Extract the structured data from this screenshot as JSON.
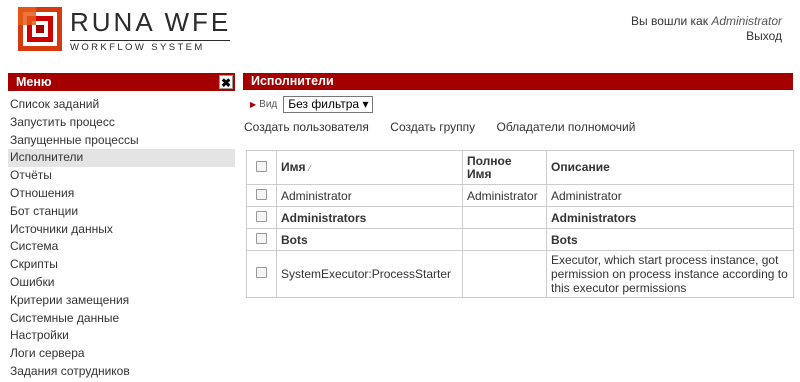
{
  "header": {
    "logo_title": "RUNA WFE",
    "logo_subtitle": "WORKFLOW SYSTEM",
    "logged_in_prefix": "Вы вошли как ",
    "username": "Administrator",
    "logout": "Выход"
  },
  "sidebar": {
    "title": "Меню",
    "close_glyph": "✖",
    "items": [
      {
        "label": "Список заданий"
      },
      {
        "label": "Запустить процесс"
      },
      {
        "label": "Запущенные процессы"
      },
      {
        "label": "Исполнители"
      },
      {
        "label": "Отчёты"
      },
      {
        "label": "Отношения"
      },
      {
        "label": "Бот станции"
      },
      {
        "label": "Источники данных"
      },
      {
        "label": "Система"
      },
      {
        "label": "Скрипты"
      },
      {
        "label": "Ошибки"
      },
      {
        "label": "Критерии замещения"
      },
      {
        "label": "Системные данные"
      },
      {
        "label": "Настройки"
      },
      {
        "label": "Логи сервера"
      },
      {
        "label": "Задания сотрудников"
      }
    ],
    "active_index": 3
  },
  "main": {
    "title": "Исполнители",
    "filter_label": "Вид",
    "filter_value": "Без фильтра",
    "actions": [
      "Создать пользователя",
      "Создать группу",
      "Обладатели полномочий"
    ],
    "columns": {
      "name": "Имя",
      "full_name_1": "Полное",
      "full_name_2": "Имя",
      "description": "Описание"
    },
    "rows": [
      {
        "name": "Administrator",
        "full_name": "Administrator",
        "description": "Administrator",
        "bold": false
      },
      {
        "name": "Administrators",
        "full_name": "",
        "description": "Administrators",
        "bold": true
      },
      {
        "name": "Bots",
        "full_name": "",
        "description": "Bots",
        "bold": true
      },
      {
        "name": "SystemExecutor:ProcessStarter",
        "full_name": "",
        "description": "Executor, which start process instance, got permission on process instance according to this executor permissions",
        "bold": false
      }
    ]
  },
  "colors": {
    "accent": "#a40000",
    "active_bg": "#e4e4e4"
  }
}
